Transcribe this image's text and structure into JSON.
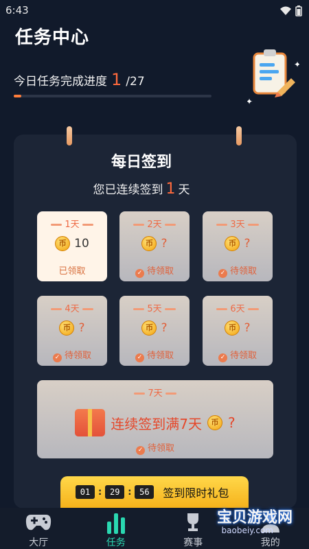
{
  "status": {
    "time": "6:43"
  },
  "header": {
    "title": "任务中心",
    "progress_label": "今日任务完成进度",
    "progress_done": "1",
    "progress_total": "/27",
    "progress_fraction": 0.037
  },
  "signin": {
    "title": "每日签到",
    "sub_prefix": "您已连续签到",
    "sub_days": "1",
    "sub_suffix": "天",
    "days": [
      {
        "label": "1天",
        "coin": "币",
        "reward": "10",
        "state": "已领取"
      },
      {
        "label": "2天",
        "coin": "币",
        "reward": "?",
        "state": "待领取"
      },
      {
        "label": "3天",
        "coin": "币",
        "reward": "?",
        "state": "待领取"
      },
      {
        "label": "4天",
        "coin": "币",
        "reward": "?",
        "state": "待领取"
      },
      {
        "label": "5天",
        "coin": "币",
        "reward": "?",
        "state": "待领取"
      },
      {
        "label": "6天",
        "coin": "币",
        "reward": "?",
        "state": "待领取"
      }
    ],
    "day7": {
      "label": "7天",
      "text": "连续签到满7天",
      "coin": "币",
      "reward": "?",
      "state": "待领取"
    }
  },
  "timer": {
    "h": "01",
    "m": "29",
    "s": "56",
    "sep": ":",
    "label": "签到限时礼包"
  },
  "nav": [
    {
      "label": "大厅",
      "icon": "gamepad-icon"
    },
    {
      "label": "任务",
      "icon": "bar-chart-icon"
    },
    {
      "label": "赛事",
      "icon": "trophy-icon"
    },
    {
      "label": "我的",
      "icon": "user-icon"
    }
  ],
  "watermark": {
    "line1": "宝贝游戏网",
    "line2": "baobeiy.com"
  },
  "colors": {
    "accent": "#ff6a3d",
    "nav_active": "#2ad8b1",
    "background": "#111a2b"
  }
}
